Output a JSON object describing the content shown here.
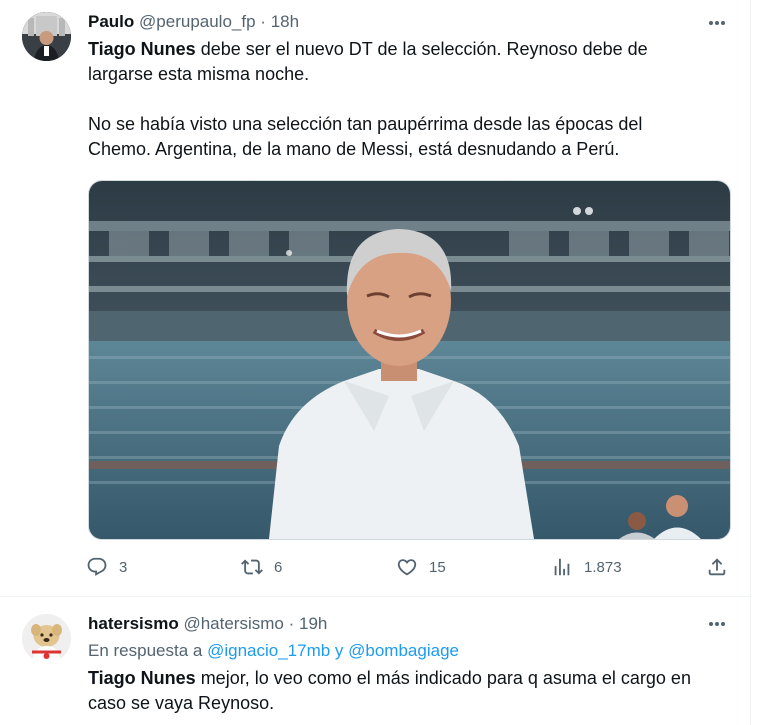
{
  "tweet1": {
    "display_name": "Paulo",
    "handle": "@perupaulo_fp",
    "separator": "·",
    "time": "18h",
    "line1_bold": "Tiago Nunes",
    "line1_rest": " debe ser el nuevo DT de la selección. Reynoso debe de",
    "line2": "largarse esta misma noche.",
    "line3": "No se había visto una selección tan paupérrima desde las épocas del",
    "line4": "Chemo. Argentina, de la mano de Messi, está desnudando a Perú.",
    "actions": {
      "replies": "3",
      "retweets": "6",
      "likes": "15",
      "views": "1.873"
    }
  },
  "tweet2": {
    "display_name": "hatersismo",
    "handle": "@hatersismo",
    "separator": "·",
    "time": "19h",
    "reply_prefix": "En respuesta a ",
    "reply_user1": "@ignacio_17mb",
    "reply_join": " y ",
    "reply_user2": "@bombagiage",
    "line1_bold": "Tiago Nunes",
    "line1_rest": " mejor, lo veo como el más indicado para q asuma el cargo en",
    "line2": "caso se vaya Reynoso."
  },
  "colors": {
    "text": "#0f1419",
    "secondary": "#536471",
    "link": "#1d9bf0",
    "border": "#eff3f4"
  },
  "icons": [
    "reply-icon",
    "retweet-icon",
    "like-icon",
    "views-icon",
    "share-icon",
    "more-icon"
  ]
}
